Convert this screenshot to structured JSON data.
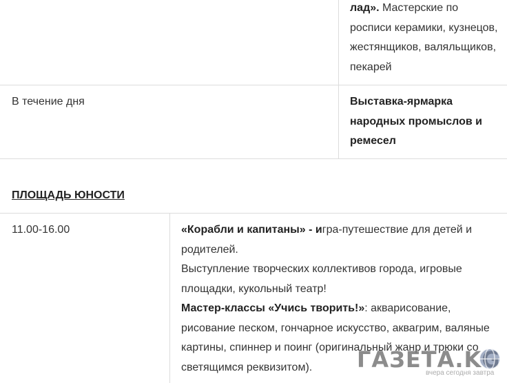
{
  "table1": {
    "row1": {
      "right_bold": "лад».",
      "right_text": " Мастерские по росписи керамики, кузнецов, жестянщиков, валяльщиков, пекарей"
    },
    "row2": {
      "time": "В течение дня",
      "event_bold": "Выставка-ярмарка народных промыслов и ремесел"
    }
  },
  "section": {
    "heading": "ПЛОЩАДЬ ЮНОСТИ"
  },
  "table2": {
    "row1": {
      "time": "11.00-16.00",
      "p1_bold": "«Корабли и капитаны» - и",
      "p1_text": "гра-путешествие для детей и родителей.",
      "p2_text": "Выступление творческих коллективов города, игровые площадки, кукольный театр!",
      "p3_bold": "Мастер-классы «Учись творить!»",
      "p3_text": ": акварисование, рисование песком, гончарное искусство, аквагрим, валяные картины, спиннер и поинг (оригинальный жанр и трюки со светящимся реквизитом)."
    }
  },
  "watermark": {
    "logo": "ГАЗЕТА.KG",
    "tagline": "вчера сегодня завтра"
  },
  "colors": {
    "text": "#333333",
    "border": "#dcdcdc",
    "watermark": "#787878"
  }
}
